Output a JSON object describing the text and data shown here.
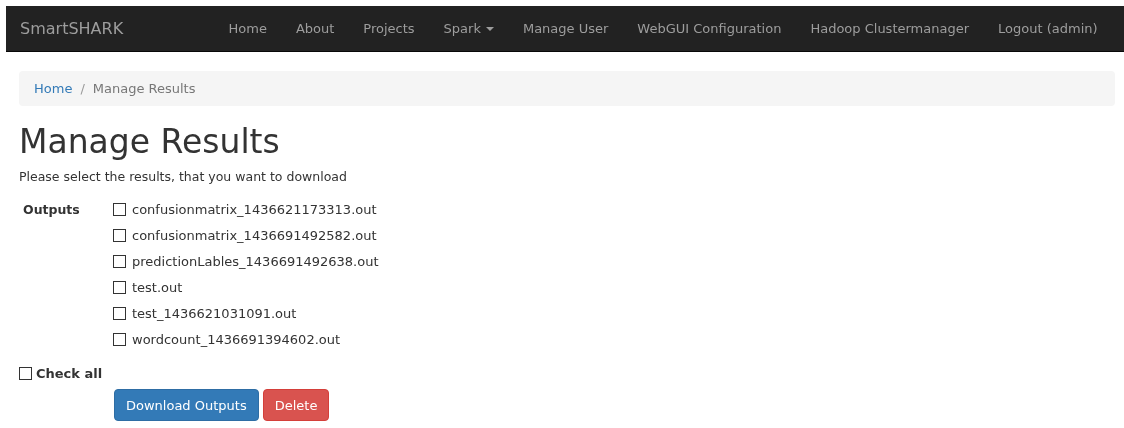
{
  "navbar": {
    "brand": "SmartSHARK",
    "items": [
      {
        "label": "Home",
        "kind": "link"
      },
      {
        "label": "About",
        "kind": "link"
      },
      {
        "label": "Projects",
        "kind": "link"
      },
      {
        "label": "Spark",
        "kind": "dropdown"
      },
      {
        "label": "Manage User",
        "kind": "link"
      },
      {
        "label": "WebGUI Configuration",
        "kind": "link"
      },
      {
        "label": "Hadoop Clustermanager",
        "kind": "link"
      },
      {
        "label": "Logout (admin)",
        "kind": "link"
      }
    ]
  },
  "breadcrumb": {
    "separator": "/",
    "items": [
      {
        "label": "Home",
        "kind": "link"
      },
      {
        "label": "Manage Results",
        "kind": "current"
      }
    ]
  },
  "heading": "Manage Results",
  "intro": "Please select the results, that you want to download",
  "outputs": {
    "label": "Outputs",
    "files": [
      {
        "name": "confusionmatrix_1436621173313.out",
        "checked": false
      },
      {
        "name": "confusionmatrix_1436691492582.out",
        "checked": false
      },
      {
        "name": "predictionLables_1436691492638.out",
        "checked": false
      },
      {
        "name": "test.out",
        "checked": false
      },
      {
        "name": "test_1436621031091.out",
        "checked": false
      },
      {
        "name": "wordcount_1436691394602.out",
        "checked": false
      }
    ]
  },
  "check_all": {
    "label": "Check all",
    "checked": false
  },
  "buttons": [
    {
      "label": "Download Outputs",
      "kind": "primary"
    },
    {
      "label": "Delete",
      "kind": "danger"
    }
  ]
}
